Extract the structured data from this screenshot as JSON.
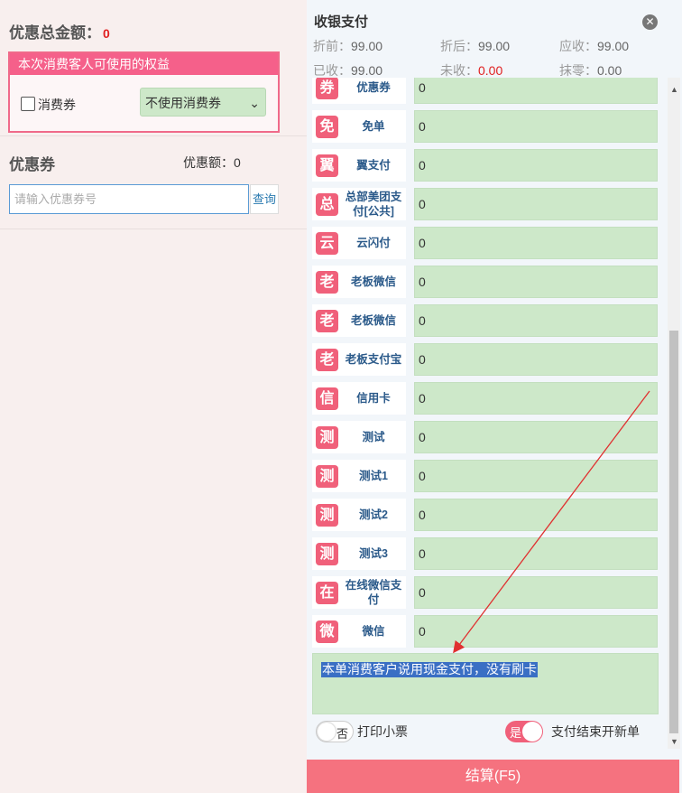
{
  "left": {
    "discount_total_label": "优惠总金额：",
    "discount_total_value": "0",
    "rights_header": "本次消费客人可使用的权益",
    "voucher_checkbox_label": "消费券",
    "voucher_select_value": "不使用消费券",
    "coupon_title": "优惠券",
    "coupon_amount_label": "优惠额：",
    "coupon_amount_value": "0",
    "coupon_input_placeholder": "请输入优惠券号",
    "query_button": "查询"
  },
  "right": {
    "title": "收银支付",
    "summary": {
      "before_discount_label": "折前：",
      "before_discount_value": "99.00",
      "after_discount_label": "折后：",
      "after_discount_value": "99.00",
      "receivable_label": "应收：",
      "receivable_value": "99.00",
      "received_label": "已收：",
      "received_value": "99.00",
      "unreceived_label": "未收：",
      "unreceived_value": "0.00",
      "rounding_label": "抹零：",
      "rounding_value": "0.00"
    },
    "payments": [
      {
        "badge": "券",
        "name": "优惠券",
        "value": "0"
      },
      {
        "badge": "免",
        "name": "免单",
        "value": "0"
      },
      {
        "badge": "翼",
        "name": "翼支付",
        "value": "0"
      },
      {
        "badge": "总",
        "name": "总部美团支付[公共]",
        "value": "0"
      },
      {
        "badge": "云",
        "name": "云闪付",
        "value": "0"
      },
      {
        "badge": "老",
        "name": "老板微信",
        "value": "0"
      },
      {
        "badge": "老",
        "name": "老板微信",
        "value": "0"
      },
      {
        "badge": "老",
        "name": "老板支付宝",
        "value": "0"
      },
      {
        "badge": "信",
        "name": "信用卡",
        "value": "0"
      },
      {
        "badge": "测",
        "name": "测试",
        "value": "0"
      },
      {
        "badge": "测",
        "name": "测试1",
        "value": "0"
      },
      {
        "badge": "测",
        "name": "测试2",
        "value": "0"
      },
      {
        "badge": "测",
        "name": "测试3",
        "value": "0"
      },
      {
        "badge": "在",
        "name": "在线微信支付",
        "value": "0"
      },
      {
        "badge": "微",
        "name": "微信",
        "value": "0"
      }
    ],
    "remark": "本单消费客户说用现金支付，没有刷卡",
    "print_toggle_state": "否",
    "print_label": "打印小票",
    "new_order_toggle_state": "是",
    "new_order_label": "支付结束开新单",
    "settle_button": "结算(F5)"
  },
  "colors": {
    "accent": "#f0607a",
    "input_green": "#cde8c9",
    "label_blue": "#2b5a8a",
    "alert_red": "#e02020"
  }
}
